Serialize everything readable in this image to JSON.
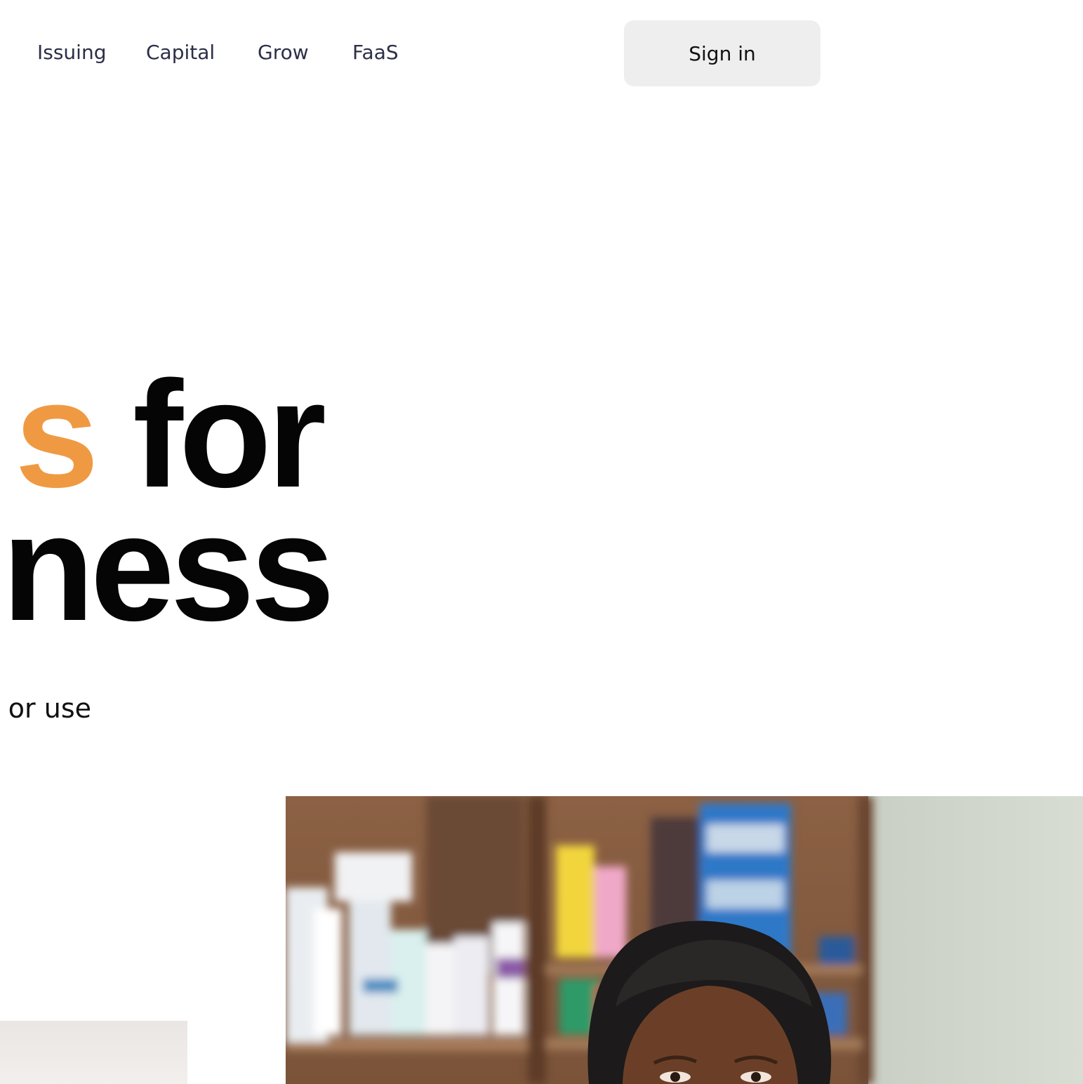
{
  "nav": {
    "links": [
      {
        "label": "Issuing"
      },
      {
        "label": "Capital"
      },
      {
        "label": "Grow"
      },
      {
        "label": "FaaS"
      }
    ],
    "sign_in_label": "Sign in"
  },
  "hero": {
    "line1_accent": "s",
    "line1_rest": " for",
    "line2": "ness",
    "subtext": "or use"
  },
  "colors": {
    "accent": "#ef9a43",
    "headline": "#050505",
    "nav_text": "#2b2f47",
    "button_bg": "#eeeeee"
  },
  "photo": {
    "icon": "shop-owner-photo"
  }
}
